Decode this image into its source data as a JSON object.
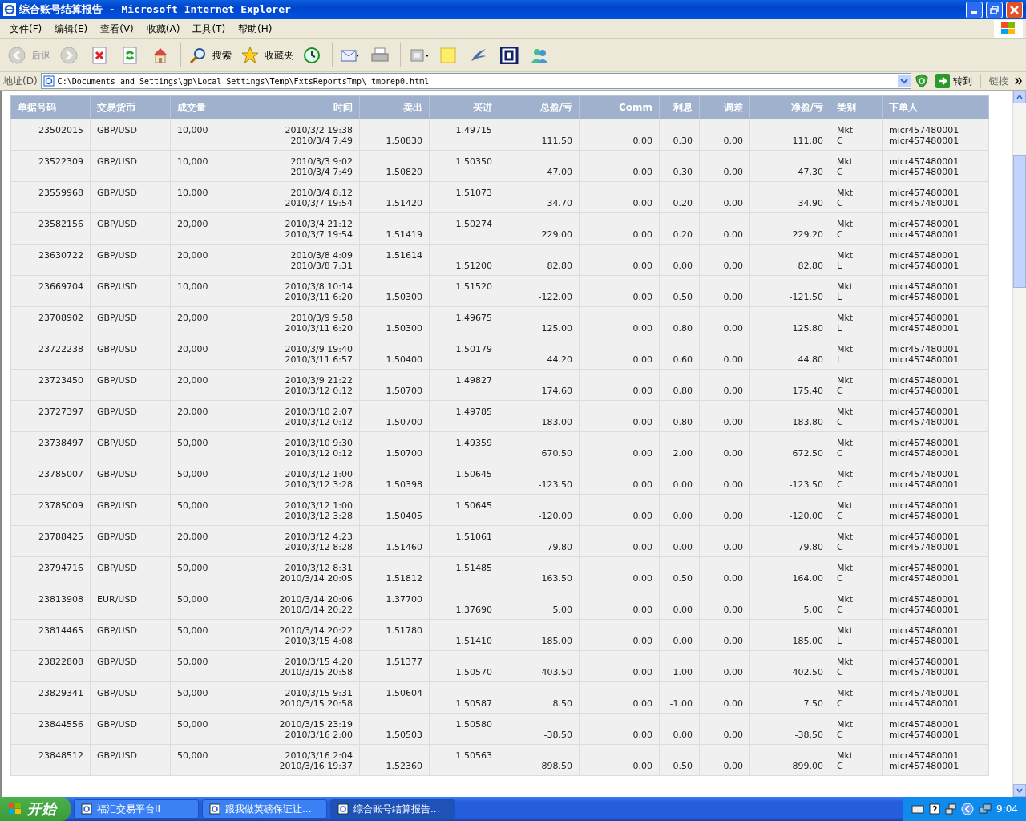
{
  "window": {
    "title": "综合账号结算报告 - Microsoft Internet Explorer"
  },
  "menu": [
    "文件(F)",
    "编辑(E)",
    "查看(V)",
    "收藏(A)",
    "工具(T)",
    "帮助(H)"
  ],
  "toolbar": [
    {
      "kind": "back",
      "label": "后退",
      "disabled": true
    },
    {
      "kind": "forward",
      "disabled": true
    },
    {
      "kind": "stop",
      "disabled": false
    },
    {
      "kind": "refresh",
      "disabled": false
    },
    {
      "kind": "home",
      "disabled": false
    },
    {
      "kind": "search",
      "label": "搜索",
      "disabled": false
    },
    {
      "kind": "favorites",
      "label": "收藏夹",
      "disabled": false
    },
    {
      "kind": "history",
      "disabled": false
    },
    {
      "kind": "mail",
      "disabled": false
    },
    {
      "kind": "print",
      "disabled": false
    },
    {
      "kind": "window",
      "disabled": false
    },
    {
      "kind": "note",
      "disabled": false
    },
    {
      "kind": "bird",
      "disabled": false
    },
    {
      "kind": "square",
      "disabled": false
    },
    {
      "kind": "people",
      "disabled": false
    }
  ],
  "address": {
    "label": "地址(D)",
    "url": "C:\\Documents and Settings\\gp\\Local Settings\\Temp\\FxtsReportsTmp\\_tmprep0.html",
    "go": "转到",
    "links": "链接"
  },
  "table": {
    "columns": [
      "单据号码",
      "交易货币",
      "成交量",
      "时间",
      "卖出",
      "买进",
      "总盈/亏",
      "Comm",
      "利息",
      "调差",
      "净盈/亏",
      "类别",
      "下单人"
    ],
    "rows": [
      {
        "id": "23502015",
        "pair": "GBP/USD",
        "volume": "10,000",
        "open_time": "2010/3/2 19:38",
        "close_time": "2010/3/4 7:49",
        "sell": "1.50830",
        "buy": "1.49715",
        "kind": "long",
        "gross": "111.50",
        "comm": "0.00",
        "interest": "0.30",
        "adjust": "0.00",
        "net": "111.80",
        "type": "Mkt",
        "type_code": "C",
        "trader_open": "micr457480001",
        "trader_close": "micr457480001"
      },
      {
        "id": "23522309",
        "pair": "GBP/USD",
        "volume": "10,000",
        "open_time": "2010/3/3 9:02",
        "close_time": "2010/3/4 7:49",
        "sell": "1.50820",
        "buy": "1.50350",
        "kind": "long",
        "gross": "47.00",
        "comm": "0.00",
        "interest": "0.30",
        "adjust": "0.00",
        "net": "47.30",
        "type": "Mkt",
        "type_code": "C",
        "trader_open": "micr457480001",
        "trader_close": "micr457480001"
      },
      {
        "id": "23559968",
        "pair": "GBP/USD",
        "volume": "10,000",
        "open_time": "2010/3/4 8:12",
        "close_time": "2010/3/7 19:54",
        "sell": "1.51420",
        "buy": "1.51073",
        "kind": "long",
        "gross": "34.70",
        "comm": "0.00",
        "interest": "0.20",
        "adjust": "0.00",
        "net": "34.90",
        "type": "Mkt",
        "type_code": "C",
        "trader_open": "micr457480001",
        "trader_close": "micr457480001"
      },
      {
        "id": "23582156",
        "pair": "GBP/USD",
        "volume": "20,000",
        "open_time": "2010/3/4 21:12",
        "close_time": "2010/3/7 19:54",
        "sell": "1.51419",
        "buy": "1.50274",
        "kind": "long",
        "gross": "229.00",
        "comm": "0.00",
        "interest": "0.20",
        "adjust": "0.00",
        "net": "229.20",
        "type": "Mkt",
        "type_code": "C",
        "trader_open": "micr457480001",
        "trader_close": "micr457480001"
      },
      {
        "id": "23630722",
        "pair": "GBP/USD",
        "volume": "20,000",
        "open_time": "2010/3/8 4:09",
        "close_time": "2010/3/8 7:31",
        "sell": "1.51614",
        "buy": "1.51200",
        "kind": "short",
        "gross": "82.80",
        "comm": "0.00",
        "interest": "0.00",
        "adjust": "0.00",
        "net": "82.80",
        "type": "Mkt",
        "type_code": "L",
        "trader_open": "micr457480001",
        "trader_close": "micr457480001"
      },
      {
        "id": "23669704",
        "pair": "GBP/USD",
        "volume": "10,000",
        "open_time": "2010/3/8 10:14",
        "close_time": "2010/3/11 6:20",
        "sell": "1.50300",
        "buy": "1.51520",
        "kind": "long",
        "gross": "-122.00",
        "comm": "0.00",
        "interest": "0.50",
        "adjust": "0.00",
        "net": "-121.50",
        "type": "Mkt",
        "type_code": "L",
        "trader_open": "micr457480001",
        "trader_close": "micr457480001"
      },
      {
        "id": "23708902",
        "pair": "GBP/USD",
        "volume": "20,000",
        "open_time": "2010/3/9 9:58",
        "close_time": "2010/3/11 6:20",
        "sell": "1.50300",
        "buy": "1.49675",
        "kind": "long",
        "gross": "125.00",
        "comm": "0.00",
        "interest": "0.80",
        "adjust": "0.00",
        "net": "125.80",
        "type": "Mkt",
        "type_code": "L",
        "trader_open": "micr457480001",
        "trader_close": "micr457480001"
      },
      {
        "id": "23722238",
        "pair": "GBP/USD",
        "volume": "20,000",
        "open_time": "2010/3/9 19:40",
        "close_time": "2010/3/11 6:57",
        "sell": "1.50400",
        "buy": "1.50179",
        "kind": "long",
        "gross": "44.20",
        "comm": "0.00",
        "interest": "0.60",
        "adjust": "0.00",
        "net": "44.80",
        "type": "Mkt",
        "type_code": "L",
        "trader_open": "micr457480001",
        "trader_close": "micr457480001"
      },
      {
        "id": "23723450",
        "pair": "GBP/USD",
        "volume": "20,000",
        "open_time": "2010/3/9 21:22",
        "close_time": "2010/3/12 0:12",
        "sell": "1.50700",
        "buy": "1.49827",
        "kind": "long",
        "gross": "174.60",
        "comm": "0.00",
        "interest": "0.80",
        "adjust": "0.00",
        "net": "175.40",
        "type": "Mkt",
        "type_code": "C",
        "trader_open": "micr457480001",
        "trader_close": "micr457480001"
      },
      {
        "id": "23727397",
        "pair": "GBP/USD",
        "volume": "20,000",
        "open_time": "2010/3/10 2:07",
        "close_time": "2010/3/12 0:12",
        "sell": "1.50700",
        "buy": "1.49785",
        "kind": "long",
        "gross": "183.00",
        "comm": "0.00",
        "interest": "0.80",
        "adjust": "0.00",
        "net": "183.80",
        "type": "Mkt",
        "type_code": "C",
        "trader_open": "micr457480001",
        "trader_close": "micr457480001"
      },
      {
        "id": "23738497",
        "pair": "GBP/USD",
        "volume": "50,000",
        "open_time": "2010/3/10 9:30",
        "close_time": "2010/3/12 0:12",
        "sell": "1.50700",
        "buy": "1.49359",
        "kind": "long",
        "gross": "670.50",
        "comm": "0.00",
        "interest": "2.00",
        "adjust": "0.00",
        "net": "672.50",
        "type": "Mkt",
        "type_code": "C",
        "trader_open": "micr457480001",
        "trader_close": "micr457480001"
      },
      {
        "id": "23785007",
        "pair": "GBP/USD",
        "volume": "50,000",
        "open_time": "2010/3/12 1:00",
        "close_time": "2010/3/12 3:28",
        "sell": "1.50398",
        "buy": "1.50645",
        "kind": "long",
        "gross": "-123.50",
        "comm": "0.00",
        "interest": "0.00",
        "adjust": "0.00",
        "net": "-123.50",
        "type": "Mkt",
        "type_code": "C",
        "trader_open": "micr457480001",
        "trader_close": "micr457480001"
      },
      {
        "id": "23785009",
        "pair": "GBP/USD",
        "volume": "50,000",
        "open_time": "2010/3/12 1:00",
        "close_time": "2010/3/12 3:28",
        "sell": "1.50405",
        "buy": "1.50645",
        "kind": "long",
        "gross": "-120.00",
        "comm": "0.00",
        "interest": "0.00",
        "adjust": "0.00",
        "net": "-120.00",
        "type": "Mkt",
        "type_code": "C",
        "trader_open": "micr457480001",
        "trader_close": "micr457480001"
      },
      {
        "id": "23788425",
        "pair": "GBP/USD",
        "volume": "20,000",
        "open_time": "2010/3/12 4:23",
        "close_time": "2010/3/12 8:28",
        "sell": "1.51460",
        "buy": "1.51061",
        "kind": "long",
        "gross": "79.80",
        "comm": "0.00",
        "interest": "0.00",
        "adjust": "0.00",
        "net": "79.80",
        "type": "Mkt",
        "type_code": "C",
        "trader_open": "micr457480001",
        "trader_close": "micr457480001"
      },
      {
        "id": "23794716",
        "pair": "GBP/USD",
        "volume": "50,000",
        "open_time": "2010/3/12 8:31",
        "close_time": "2010/3/14 20:05",
        "sell": "1.51812",
        "buy": "1.51485",
        "kind": "long",
        "gross": "163.50",
        "comm": "0.00",
        "interest": "0.50",
        "adjust": "0.00",
        "net": "164.00",
        "type": "Mkt",
        "type_code": "C",
        "trader_open": "micr457480001",
        "trader_close": "micr457480001"
      },
      {
        "id": "23813908",
        "pair": "EUR/USD",
        "volume": "50,000",
        "open_time": "2010/3/14 20:06",
        "close_time": "2010/3/14 20:22",
        "sell": "1.37700",
        "buy": "1.37690",
        "kind": "short",
        "gross": "5.00",
        "comm": "0.00",
        "interest": "0.00",
        "adjust": "0.00",
        "net": "5.00",
        "type": "Mkt",
        "type_code": "C",
        "trader_open": "micr457480001",
        "trader_close": "micr457480001"
      },
      {
        "id": "23814465",
        "pair": "GBP/USD",
        "volume": "50,000",
        "open_time": "2010/3/14 20:22",
        "close_time": "2010/3/15 4:08",
        "sell": "1.51780",
        "buy": "1.51410",
        "kind": "short",
        "gross": "185.00",
        "comm": "0.00",
        "interest": "0.00",
        "adjust": "0.00",
        "net": "185.00",
        "type": "Mkt",
        "type_code": "L",
        "trader_open": "micr457480001",
        "trader_close": "micr457480001"
      },
      {
        "id": "23822808",
        "pair": "GBP/USD",
        "volume": "50,000",
        "open_time": "2010/3/15 4:20",
        "close_time": "2010/3/15 20:58",
        "sell": "1.51377",
        "buy": "1.50570",
        "kind": "short",
        "gross": "403.50",
        "comm": "0.00",
        "interest": "-1.00",
        "adjust": "0.00",
        "net": "402.50",
        "type": "Mkt",
        "type_code": "C",
        "trader_open": "micr457480001",
        "trader_close": "micr457480001"
      },
      {
        "id": "23829341",
        "pair": "GBP/USD",
        "volume": "50,000",
        "open_time": "2010/3/15 9:31",
        "close_time": "2010/3/15 20:58",
        "sell": "1.50604",
        "buy": "1.50587",
        "kind": "short",
        "gross": "8.50",
        "comm": "0.00",
        "interest": "-1.00",
        "adjust": "0.00",
        "net": "7.50",
        "type": "Mkt",
        "type_code": "C",
        "trader_open": "micr457480001",
        "trader_close": "micr457480001"
      },
      {
        "id": "23844556",
        "pair": "GBP/USD",
        "volume": "50,000",
        "open_time": "2010/3/15 23:19",
        "close_time": "2010/3/16 2:00",
        "sell": "1.50503",
        "buy": "1.50580",
        "kind": "long",
        "gross": "-38.50",
        "comm": "0.00",
        "interest": "0.00",
        "adjust": "0.00",
        "net": "-38.50",
        "type": "Mkt",
        "type_code": "C",
        "trader_open": "micr457480001",
        "trader_close": "micr457480001"
      },
      {
        "id": "23848512",
        "pair": "GBP/USD",
        "volume": "50,000",
        "open_time": "2010/3/16 2:04",
        "close_time": "2010/3/16 19:37",
        "sell": "1.52360",
        "buy": "1.50563",
        "kind": "long",
        "gross": "898.50",
        "comm": "0.00",
        "interest": "0.50",
        "adjust": "0.00",
        "net": "899.00",
        "type": "Mkt",
        "type_code": "C",
        "trader_open": "micr457480001",
        "trader_close": "micr457480001"
      }
    ]
  },
  "taskbar": {
    "start": "开始",
    "tasks": [
      {
        "label": "福汇交易平台II",
        "selected": false
      },
      {
        "label": "跟我做英磅保证让...",
        "selected": false
      },
      {
        "label": "综合账号结算报告...",
        "selected": true
      }
    ],
    "clock": "9:04"
  }
}
